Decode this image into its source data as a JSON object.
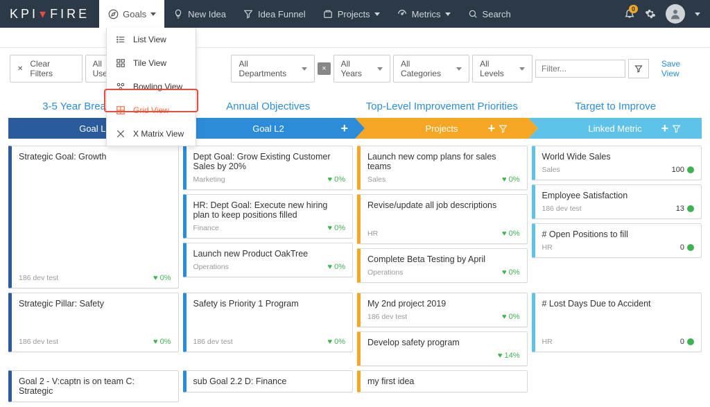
{
  "brand": {
    "k": "K",
    "p": "P",
    "i": "I",
    "f": "F",
    "i2": "I",
    "r": "R",
    "e": "E"
  },
  "nav": {
    "goals": "Goals",
    "newIdea": "New Idea",
    "ideaFunnel": "Idea Funnel",
    "projects": "Projects",
    "metrics": "Metrics",
    "search": "Search",
    "bellCount": "0"
  },
  "goalsMenu": {
    "list": "List View",
    "tile": "Tile View",
    "bowling": "Bowling View",
    "grid": "Grid View",
    "xmatrix": "X Matrix View"
  },
  "filters": {
    "clear": "Clear Filters",
    "users": "All Users",
    "depts": "All Departments",
    "years": "All Years",
    "cats": "All Categories",
    "levels": "All Levels",
    "filterPlaceholder": "Filter...",
    "save": "Save View"
  },
  "laneTitles": {
    "l1": "3-5 Year Breakthrough",
    "l2": "Annual Objectives",
    "l3": "Top-Level Improvement Priorities",
    "l4": "Target to Improve"
  },
  "chevrons": {
    "c1": "Goal L1",
    "c2": "Goal L2",
    "c3": "Projects",
    "c4": "Linked Metric"
  },
  "data": {
    "r1": {
      "goal": {
        "title": "Strategic Goal: Growth",
        "owner": "186 dev test",
        "pct": "0%"
      },
      "objs": [
        {
          "title": "Dept Goal: Grow Existing Customer Sales by 20%",
          "owner": "Marketing",
          "pct": "0%"
        },
        {
          "title": "HR: Dept Goal: Execute new hiring plan to keep positions filled",
          "owner": "Finance",
          "pct": "0%"
        },
        {
          "title": "Launch new Product OakTree",
          "owner": "Operations",
          "pct": "0%"
        }
      ],
      "projects": [
        {
          "title": "Launch new comp plans for sales teams",
          "owner": "Sales",
          "pct": "0%"
        },
        {
          "title": "Revise/update all job descriptions",
          "owner": "HR",
          "pct": "0%"
        },
        {
          "title": "Complete Beta Testing by April",
          "owner": "Operations",
          "pct": "0%"
        }
      ],
      "metrics": [
        {
          "title": "World Wide Sales",
          "owner": "Sales",
          "val": "100"
        },
        {
          "title": "Employee Satisfaction",
          "owner": "186 dev test",
          "val": "13"
        },
        {
          "title": "# Open Positions to fill",
          "owner": "HR",
          "val": "0"
        }
      ]
    },
    "r2": {
      "goal": {
        "title": "Strategic Pillar: Safety",
        "owner": "186 dev test",
        "pct": "0%"
      },
      "objs": [
        {
          "title": "Safety is Priority 1 Program",
          "owner": "186 dev test",
          "pct": "0%"
        }
      ],
      "projects": [
        {
          "title": "My 2nd project 2019",
          "owner": "186 dev test",
          "pct": "0%"
        },
        {
          "title": "Develop safety program",
          "owner": "",
          "pct": "14%"
        }
      ],
      "metrics": [
        {
          "title": "# Lost Days Due to Accident",
          "owner": "HR",
          "val": "0"
        }
      ]
    },
    "r3": {
      "goal": {
        "title": "Goal 2 - V:captn is on team C: Strategic"
      },
      "objs": [
        {
          "title": "sub Goal 2.2 D: Finance"
        }
      ],
      "projects": [
        {
          "title": "my first idea"
        }
      ]
    }
  }
}
